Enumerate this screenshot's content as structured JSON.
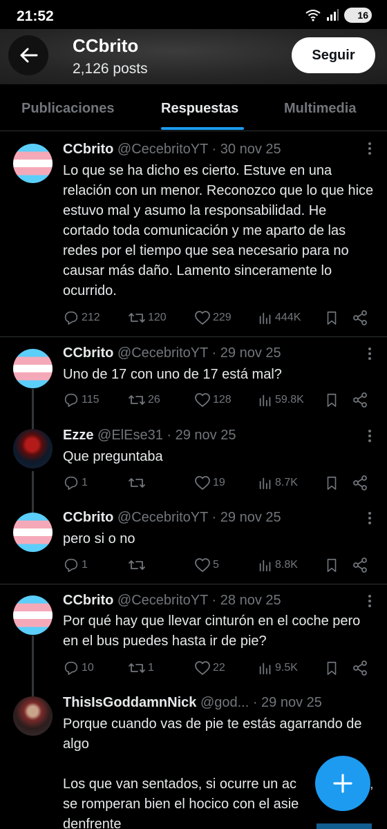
{
  "status": {
    "time": "21:52",
    "battery": "16"
  },
  "header": {
    "name": "CCbrito",
    "posts": "2,126 posts",
    "follow_label": "Seguir"
  },
  "tabs": [
    {
      "label": "Publicaciones"
    },
    {
      "label": "Respuestas"
    },
    {
      "label": "Multimedia"
    }
  ],
  "tweets": [
    {
      "name": "CCbrito",
      "handle": "@CecebritoYT",
      "date": "· 30 nov 25",
      "text": "Lo que se ha dicho es cierto. Estuve en una relación con un menor. Reconozco que lo que hice estuvo mal y asumo la responsabilidad. He cortado toda comunicación y me aparto de las redes por el tiempo que sea necesario para no causar más daño. Lamento sinceramente lo ocurrido.",
      "replies": "212",
      "reposts": "120",
      "likes": "229",
      "views": "444K"
    },
    {
      "name": "CCbrito",
      "handle": "@CecebritoYT",
      "date": "· 29 nov 25",
      "text": "Uno de 17 con uno de 17 está mal?",
      "replies": "115",
      "reposts": "26",
      "likes": "128",
      "views": "59.8K"
    },
    {
      "name": "Ezze",
      "handle": "@ElEse31",
      "date": "· 29 nov 25",
      "text": "Que preguntaba",
      "replies": "1",
      "reposts": "",
      "likes": "19",
      "views": "8.7K"
    },
    {
      "name": "CCbrito",
      "handle": "@CecebritoYT",
      "date": "· 29 nov 25",
      "text": "pero si o no",
      "replies": "1",
      "reposts": "",
      "likes": "5",
      "views": "8.8K"
    },
    {
      "name": "CCbrito",
      "handle": "@CecebritoYT",
      "date": "· 28 nov 25",
      "text": "Por qué hay que llevar cinturón en el coche pero en el bus puedes hasta ir de pie?",
      "replies": "10",
      "reposts": "1",
      "likes": "22",
      "views": "9.5K"
    },
    {
      "name": "ThisIsGoddamnNick",
      "handle": "@god...",
      "date": "· 29 nov 25",
      "text": "Porque cuando vas de pie te estás agarrando de algo",
      "text2": "Los que van sentados, si ocurre un ac",
      "text2b": ",",
      "text3": "se romperan bien el hocico con el asie",
      "text4": "denfrente"
    }
  ],
  "colors": {
    "accent": "#1d9bf0",
    "background": "#000000",
    "muted": "#71767b",
    "text": "#e7e9ea"
  }
}
